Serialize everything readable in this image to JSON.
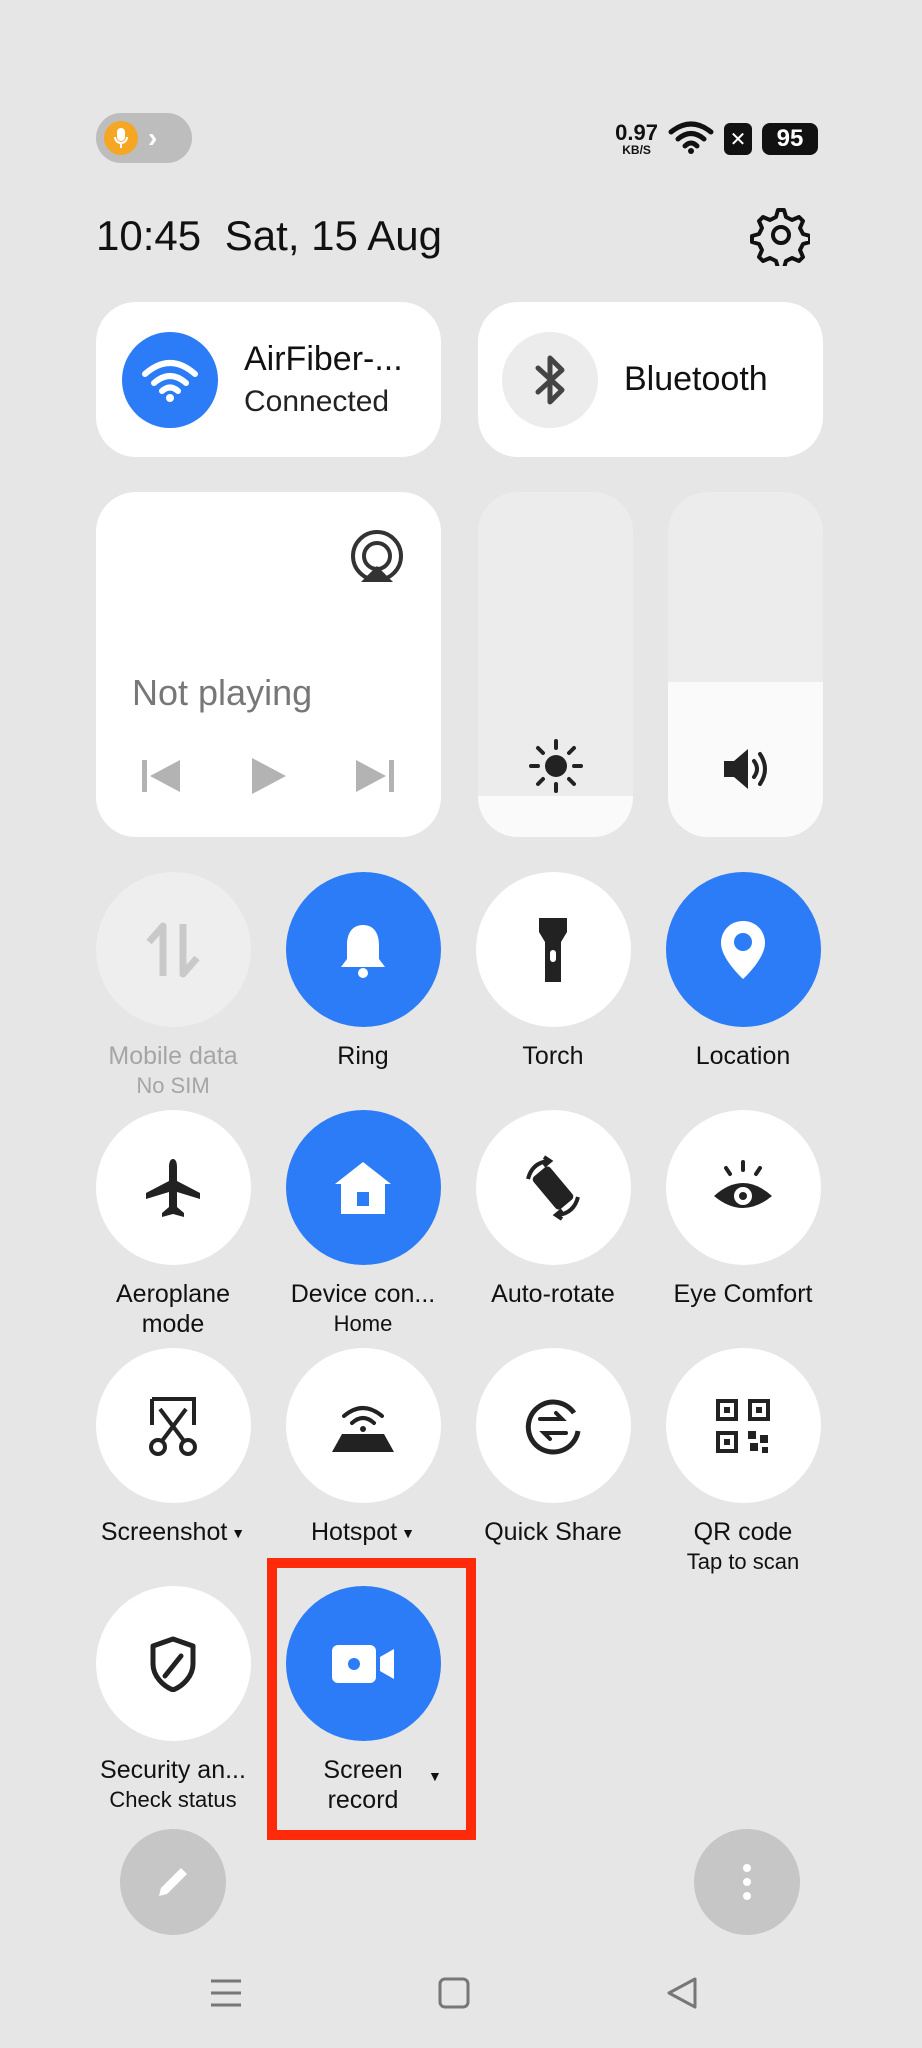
{
  "status_bar": {
    "net_speed_value": "0.97",
    "net_speed_unit": "KB/S",
    "battery": "95"
  },
  "header": {
    "time": "10:45",
    "date": "Sat, 15 Aug"
  },
  "wifi_card": {
    "title": "AirFiber-...",
    "status": "Connected"
  },
  "bluetooth_card": {
    "title": "Bluetooth"
  },
  "media": {
    "status": "Not playing"
  },
  "sliders": {
    "brightness_level": 0.12,
    "volume_level": 0.45
  },
  "tiles": [
    {
      "label": "Mobile data",
      "sub": "No SIM"
    },
    {
      "label": "Ring",
      "sub": ""
    },
    {
      "label": "Torch",
      "sub": ""
    },
    {
      "label": "Location",
      "sub": ""
    },
    {
      "label": "Aeroplane",
      "label2": "mode"
    },
    {
      "label": "Device con...",
      "sub": "Home"
    },
    {
      "label": "Auto-rotate",
      "sub": ""
    },
    {
      "label": "Eye Comfort",
      "sub": ""
    },
    {
      "label": "Screenshot",
      "sub": ""
    },
    {
      "label": "Hotspot",
      "sub": ""
    },
    {
      "label": "Quick Share",
      "sub": ""
    },
    {
      "label": "QR code",
      "sub": "Tap to scan"
    },
    {
      "label": "Security an...",
      "sub": "Check status"
    },
    {
      "label": "Screen",
      "label2": "record"
    }
  ],
  "colors": {
    "accent": "#2b7cf6",
    "highlight": "#ff2a0a",
    "background": "#e6e6e6"
  }
}
